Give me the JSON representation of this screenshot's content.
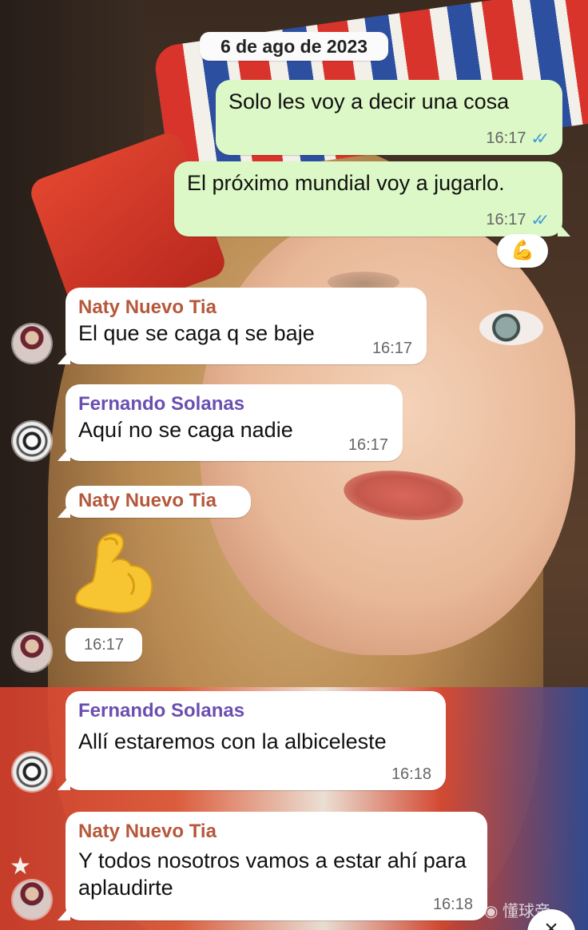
{
  "chat": {
    "date": "6 de ago de 2023",
    "messages": [
      {
        "direction": "out",
        "text": "Solo les voy a decir una cosa",
        "time": "16:17",
        "status": "read"
      },
      {
        "direction": "out",
        "text": "El próximo mundial voy a jugarlo.",
        "time": "16:17",
        "status": "read",
        "reaction": "💪"
      },
      {
        "direction": "in",
        "sender": "Naty Nuevo Tia",
        "text": "El que se caga q se baje",
        "time": "16:17"
      },
      {
        "direction": "in",
        "sender": "Fernando Solanas",
        "text": "Aquí no se caga nadie",
        "time": "16:17"
      },
      {
        "direction": "in",
        "sender": "Naty Nuevo Tia",
        "emoji": "💪",
        "time": "16:17"
      },
      {
        "direction": "in",
        "sender": "Fernando Solanas",
        "text": "Allí estaremos con la albiceleste",
        "time": "16:18"
      },
      {
        "direction": "in",
        "sender": "Naty Nuevo Tia",
        "text": "Y todos nosotros vamos a estar ahí para aplaudirte",
        "time": "16:18"
      }
    ]
  },
  "colors": {
    "outgoing_bubble": "#dcf8c6",
    "incoming_bubble": "#ffffff",
    "sender_naty": "#b5583c",
    "sender_fernando": "#6a4fb0",
    "read_ticks": "#3b9bd6"
  },
  "icons": {
    "read_receipt": "double-check-icon",
    "reaction": "flexed-biceps-icon",
    "close": "close-icon"
  },
  "watermark": "懂球帝"
}
